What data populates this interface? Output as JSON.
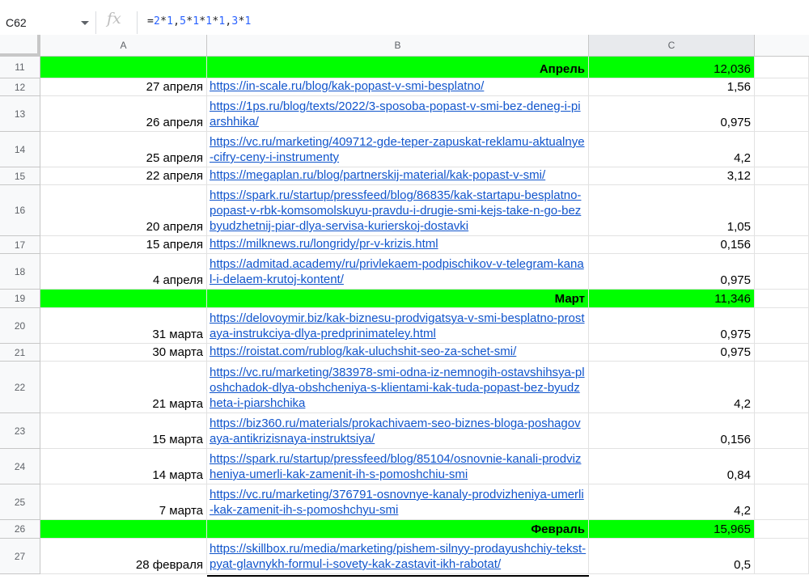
{
  "formula_bar": {
    "cell_ref": "C62",
    "fx_label": "fx",
    "formula_parts": [
      {
        "t": "=",
        "n": false
      },
      {
        "t": "2",
        "n": true
      },
      {
        "t": "*",
        "n": false
      },
      {
        "t": "1",
        "n": true
      },
      {
        "t": ",",
        "n": false
      },
      {
        "t": "5",
        "n": true
      },
      {
        "t": "*",
        "n": false
      },
      {
        "t": "1",
        "n": true
      },
      {
        "t": "*",
        "n": false
      },
      {
        "t": "1",
        "n": true
      },
      {
        "t": "*",
        "n": false
      },
      {
        "t": "1",
        "n": true
      },
      {
        "t": ",",
        "n": false
      },
      {
        "t": "3",
        "n": true
      },
      {
        "t": "*",
        "n": false
      },
      {
        "t": "1",
        "n": true
      }
    ]
  },
  "columns": [
    "A",
    "B",
    "C"
  ],
  "rows": [
    {
      "n": "11",
      "month": "Апрель",
      "value": "12,036"
    },
    {
      "n": "12",
      "date": "27 апреля",
      "url": "https://in-scale.ru/blog/kak-popast-v-smi-besplatno/",
      "value": "1,56"
    },
    {
      "n": "13",
      "date": "26 апреля",
      "url": "https://1ps.ru/blog/texts/2022/3-sposoba-popast-v-smi-bez-deneg-i-piarshhika/",
      "value": "0,975"
    },
    {
      "n": "14",
      "date": "25 апреля",
      "url": "https://vc.ru/marketing/409712-gde-teper-zapuskat-reklamu-aktualnye-cifry-ceny-i-instrumenty",
      "value": "4,2"
    },
    {
      "n": "15",
      "date": "22 апреля",
      "url": "https://megaplan.ru/blog/partnerskij-material/kak-popast-v-smi/",
      "value": "3,12"
    },
    {
      "n": "16",
      "date": "20 апреля",
      "url": "https://spark.ru/startup/pressfeed/blog/86835/kak-startapu-besplatno-popast-v-rbk-komsomolskuyu-pravdu-i-drugie-smi-kejs-take-n-go-bezbyudzhetnij-piar-dlya-servisa-kurierskoj-dostavki",
      "value": "1,05"
    },
    {
      "n": "17",
      "date": "15 апреля",
      "url": "https://milknews.ru/longridy/pr-v-krizis.html",
      "value": "0,156"
    },
    {
      "n": "18",
      "date": "4 апреля",
      "url": "https://admitad.academy/ru/privlekaem-podpischikov-v-telegram-kanal-i-delaem-krutoj-kontent/",
      "value": "0,975"
    },
    {
      "n": "19",
      "month": "Март",
      "value": "11,346"
    },
    {
      "n": "20",
      "date": "31 марта",
      "url": "https://delovoymir.biz/kak-biznesu-prodvigatsya-v-smi-besplatno-prostaya-instrukciya-dlya-predprinimateley.html",
      "value": "0,975"
    },
    {
      "n": "21",
      "date": "30 марта",
      "url": "https://roistat.com/rublog/kak-uluchshit-seo-za-schet-smi/",
      "value": "0,975"
    },
    {
      "n": "22",
      "date": "21 марта",
      "url": "https://vc.ru/marketing/383978-smi-odna-iz-nemnogih-ostavshihsya-ploshchadok-dlya-obshcheniya-s-klientami-kak-tuda-popast-bez-byudzheta-i-piarshchika",
      "value": "4,2"
    },
    {
      "n": "23",
      "date": "15 марта",
      "url": "https://biz360.ru/materials/prokachivaem-seo-biznes-bloga-poshagovaya-antikrizisnaya-instruktsiya/",
      "value": "0,156"
    },
    {
      "n": "24",
      "date": "14 марта",
      "url": "https://spark.ru/startup/pressfeed/blog/85104/osnovnie-kanali-prodvizheniya-umerli-kak-zamenit-ih-s-pomoshchiu-smi",
      "value": "0,84"
    },
    {
      "n": "25",
      "date": "7 марта",
      "url": "https://vc.ru/marketing/376791-osnovnye-kanaly-prodvizheniya-umerli-kak-zamenit-ih-s-pomoshchyu-smi",
      "value": "4,2"
    },
    {
      "n": "26",
      "month": "Февраль",
      "value": "15,965"
    },
    {
      "n": "27",
      "date": "28 февраля",
      "url": "https://skillbox.ru/media/marketing/pishem-silnyy-prodayushchiy-tekst-pyat-glavnykh-formul-i-sovety-kak-zastavit-ikh-rabotat/",
      "value": "0,5"
    }
  ],
  "colors": {
    "month_row": "#00ff00",
    "link": "#1155cc",
    "formula_number": "#2962ff"
  }
}
